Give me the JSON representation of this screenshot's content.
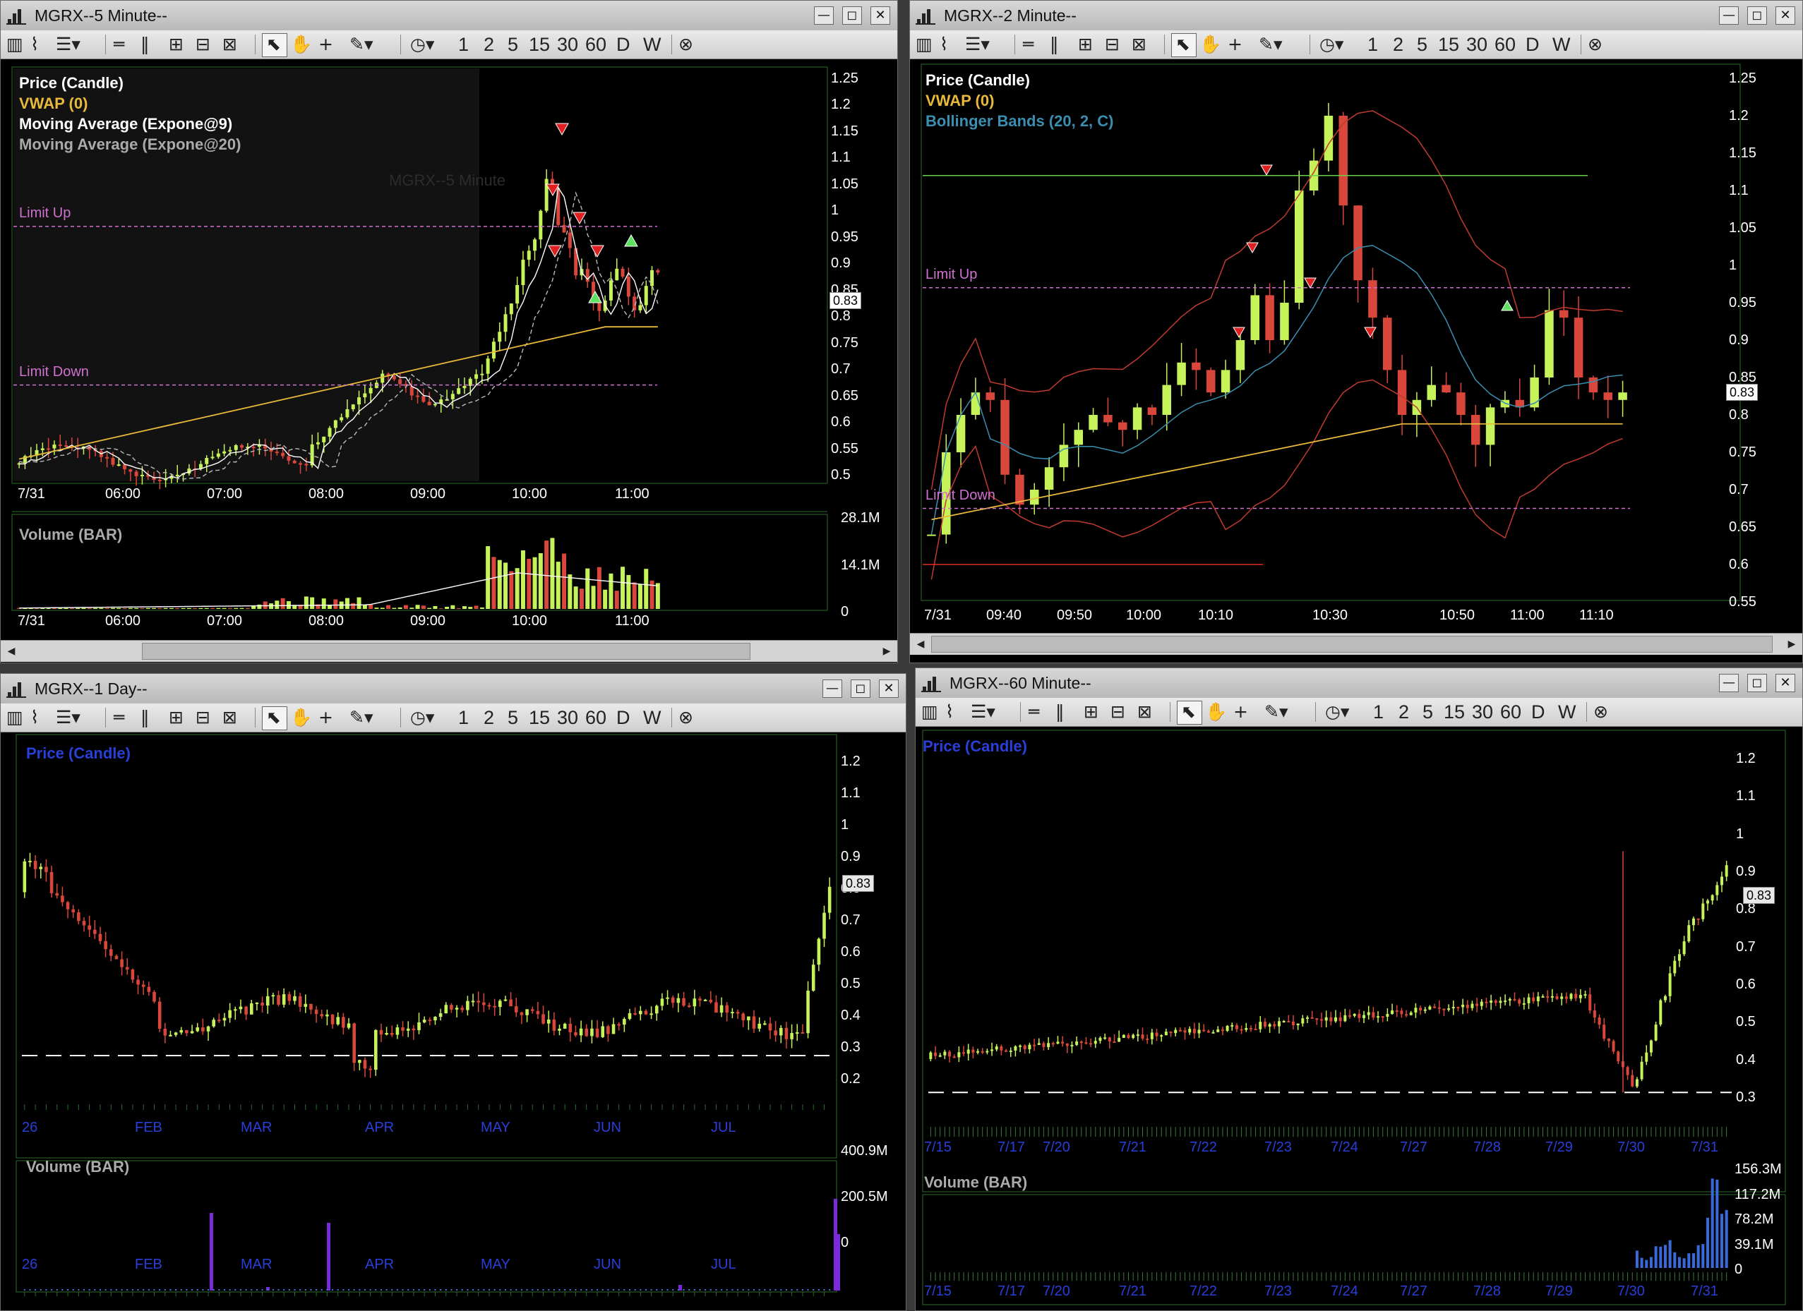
{
  "toolbar": {
    "intervals": [
      "1",
      "2",
      "5",
      "15",
      "30",
      "60",
      "D",
      "W"
    ]
  },
  "windows": {
    "w5": {
      "title": "MGRX--5 Minute--",
      "watermark": "MGRX--5 Minute",
      "legend": [
        "Price (Candle)",
        "VWAP (0)",
        "Moving Average (Expone@9)",
        "Moving Average (Expone@20)"
      ],
      "limit_up": "Limit Up",
      "limit_down": "Limit Down",
      "price_ticks": [
        "1.25",
        "1.2",
        "1.15",
        "1.1",
        "1.05",
        "1",
        "0.95",
        "0.9",
        "0.85",
        "0.8",
        "0.75",
        "0.7",
        "0.65",
        "0.6",
        "0.55",
        "0.5"
      ],
      "last_price": "0.83",
      "date_label": "7/31",
      "time_ticks": [
        "06:00",
        "07:00",
        "08:00",
        "09:00",
        "10:00",
        "11:00"
      ],
      "volume_label": "Volume (BAR)",
      "volume_ticks": [
        "28.1M",
        "14.1M",
        "0"
      ]
    },
    "w2": {
      "title": "MGRX--2 Minute--",
      "legend": [
        "Price (Candle)",
        "VWAP (0)",
        "Bollinger Bands (20, 2, C)"
      ],
      "limit_up": "Limit Up",
      "limit_down": "Limit Down",
      "price_ticks": [
        "1.25",
        "1.2",
        "1.15",
        "1.1",
        "1.05",
        "1",
        "0.95",
        "0.9",
        "0.85",
        "0.8",
        "0.75",
        "0.7",
        "0.65",
        "0.6",
        "0.55"
      ],
      "last_price": "0.83",
      "date_label": "7/31",
      "time_ticks": [
        "09:40",
        "09:50",
        "10:00",
        "10:10",
        "10:30",
        "10:50",
        "11:00",
        "11:10"
      ]
    },
    "w1d": {
      "title": "MGRX--1 Day--",
      "legend": [
        "Price (Candle)"
      ],
      "price_ticks": [
        "1.2",
        "1.1",
        "1",
        "0.9",
        "0.8",
        "0.7",
        "0.6",
        "0.5",
        "0.4",
        "0.3",
        "0.2"
      ],
      "last_price": "0.83",
      "date_ticks": [
        "26",
        "FEB",
        "MAR",
        "APR",
        "MAY",
        "JUN",
        "JUL"
      ],
      "volume_label": "Volume (BAR)",
      "volume_ticks": [
        "400.9M",
        "200.5M",
        "0"
      ]
    },
    "w60": {
      "title": "MGRX--60 Minute--",
      "legend": [
        "Price (Candle)"
      ],
      "price_ticks": [
        "1.2",
        "1.1",
        "1",
        "0.9",
        "0.8",
        "0.7",
        "0.6",
        "0.5",
        "0.4",
        "0.3"
      ],
      "last_price": "0.83",
      "date_ticks": [
        "7/15",
        "7/17",
        "7/20",
        "7/21",
        "7/22",
        "7/23",
        "7/24",
        "7/27",
        "7/28",
        "7/29",
        "7/30",
        "7/31"
      ],
      "volume_label": "Volume (BAR)",
      "volume_ticks": [
        "156.3M",
        "117.2M",
        "78.2M",
        "39.1M",
        "0"
      ]
    }
  },
  "colors": {
    "up": "#c6f25a",
    "down": "#d9463b",
    "vwap": "#e8b93a",
    "bollinger": "#3a8fb0",
    "limit": "#d070d0",
    "daily_legend": "#2a3fd9"
  },
  "chart_data": [
    {
      "type": "candlestick",
      "title": "MGRX--5 Minute--",
      "x": [
        "06:00",
        "07:00",
        "08:00",
        "09:00",
        "10:00",
        "11:00"
      ],
      "ylim": [
        0.5,
        1.25
      ],
      "last": 0.83,
      "limit_up": 0.97,
      "limit_down": 0.67
    },
    {
      "type": "candlestick",
      "title": "MGRX--2 Minute--",
      "x": [
        "09:40",
        "09:50",
        "10:00",
        "10:10",
        "10:30",
        "10:50",
        "11:00",
        "11:10"
      ],
      "ylim": [
        0.55,
        1.25
      ],
      "last": 0.83
    },
    {
      "type": "candlestick",
      "title": "MGRX--1 Day--",
      "x": [
        "26",
        "FEB",
        "MAR",
        "APR",
        "MAY",
        "JUN",
        "JUL"
      ],
      "ylim": [
        0.15,
        1.25
      ],
      "last": 0.83
    },
    {
      "type": "candlestick",
      "title": "MGRX--60 Minute--",
      "x": [
        "7/15",
        "7/17",
        "7/20",
        "7/21",
        "7/22",
        "7/23",
        "7/24",
        "7/27",
        "7/28",
        "7/29",
        "7/30",
        "7/31"
      ],
      "ylim": [
        0.25,
        1.25
      ],
      "last": 0.83
    }
  ]
}
